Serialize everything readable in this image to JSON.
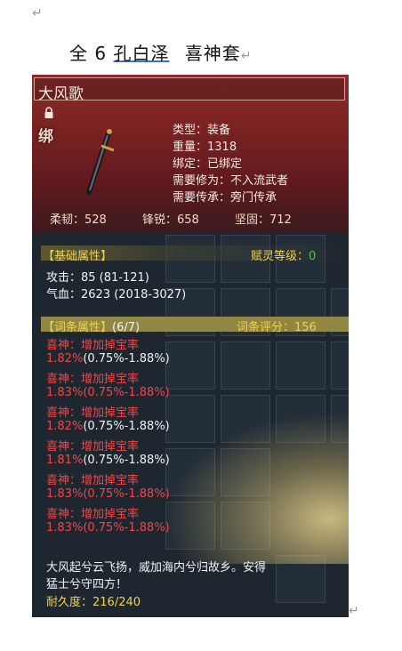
{
  "document": {
    "title_prefix": "全 6 ",
    "title_name": "孔白泽",
    "title_suffix": "喜神套",
    "paragraph_mark": "↵",
    "line_end_mark": "↵"
  },
  "item": {
    "name": "大风歌",
    "bind_badge": "绑",
    "type": "类型：装备",
    "weight": "重量：1318",
    "binding": "绑定：已绑定",
    "req_cultivation": "需要修为：不入流武者",
    "req_lineage": "需要传承：旁门传承",
    "toughness": "柔韧：528",
    "sharpness": "锋锐：658",
    "firmness": "坚固：712"
  },
  "base_section": {
    "label": "【基础属性】",
    "spirit_label": "赋灵等级：",
    "spirit_value": "0",
    "attack": "攻击：85 (81-121)",
    "hp": "气血：2623 (2018-3027)"
  },
  "affix_section": {
    "label": "【词条属性】",
    "count": "(6/7)",
    "score": "词条评分：156",
    "affixes": [
      {
        "name": "喜神：增加掉宝率",
        "value": "1.82%",
        "range": "(0.75%-1.88%)",
        "range_red": false
      },
      {
        "name": "喜神：增加掉宝率",
        "value": "1.83%",
        "range": "(0.75%-1.88%)",
        "range_red": true
      },
      {
        "name": "喜神：增加掉宝率",
        "value": "1.82%",
        "range": "(0.75%-1.88%)",
        "range_red": false
      },
      {
        "name": "喜神：增加掉宝率",
        "value": "1.81%",
        "range": "(0.75%-1.88%)",
        "range_red": false
      },
      {
        "name": "喜神：增加掉宝率",
        "value": "1.83%",
        "range": "(0.75%-1.88%)",
        "range_red": true
      },
      {
        "name": "喜神：增加掉宝率",
        "value": "1.83%",
        "range": "(0.75%-1.88%)",
        "range_red": true
      }
    ]
  },
  "flavor": {
    "line1": "大风起兮云飞扬，威加海内兮归故乡。安得",
    "line2": "猛士兮守四方！"
  },
  "durability": "耐久度：216/240",
  "icons": {
    "lock": "lock-icon",
    "sword": "sword-icon"
  },
  "colors": {
    "header_red": "#7a2222",
    "panel_bg": "#1e2630",
    "section_gold": "#f0d050",
    "affix_red": "#f04848",
    "spirit_green": "#40d040"
  }
}
